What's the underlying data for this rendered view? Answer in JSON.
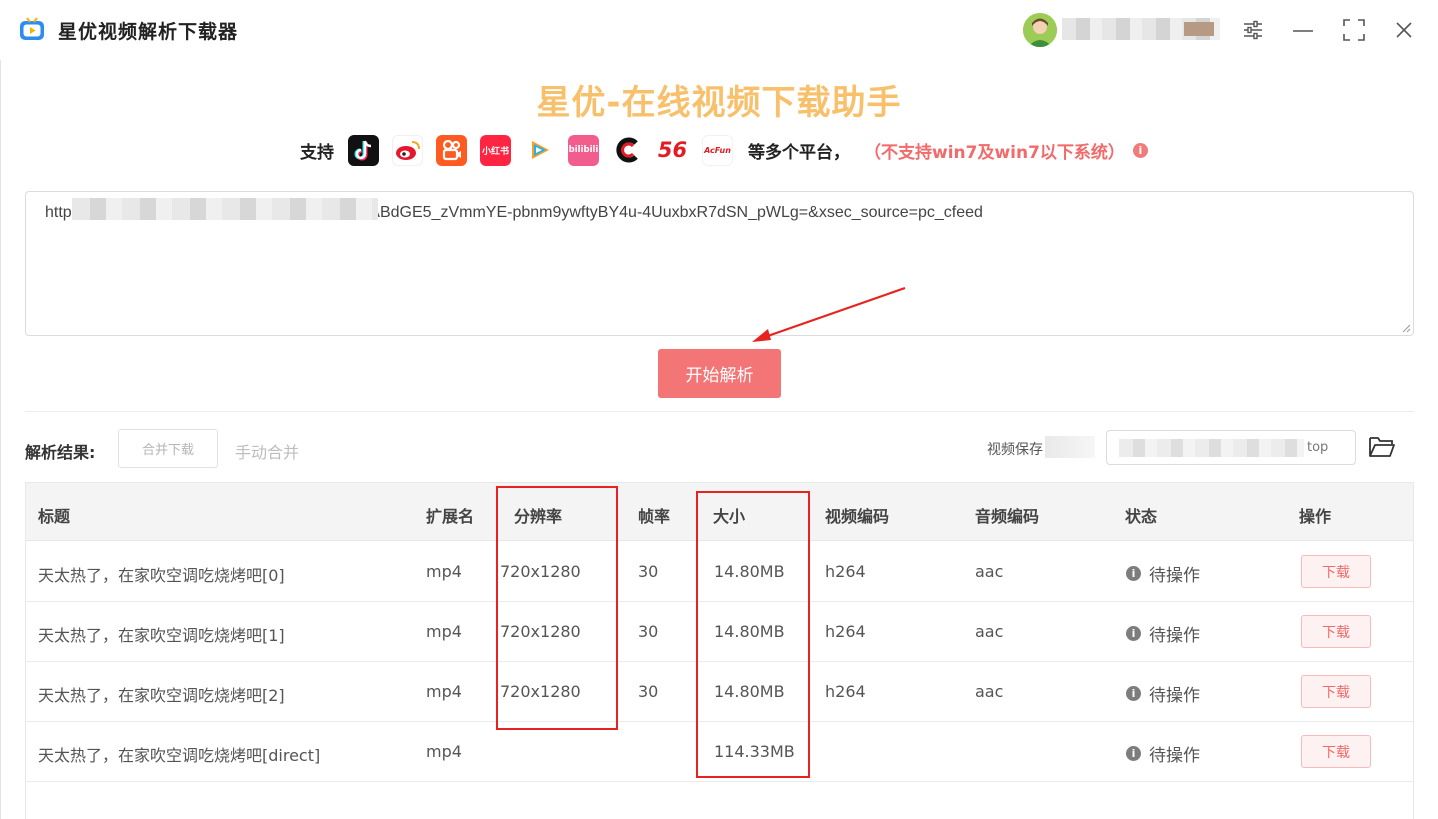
{
  "app": {
    "title": "星优视频解析下载器"
  },
  "window_controls": [
    "settings-icon",
    "minimize-icon",
    "maximize-icon",
    "close-icon"
  ],
  "header": {
    "headline": "星优-在线视频下载助手",
    "support_label": "支持",
    "support_more": "等多个平台，",
    "support_warning": "（不支持win7及win7以下系统）",
    "info_glyph": "i"
  },
  "platforms": [
    {
      "name": "tiktok-icon",
      "label": "",
      "bg": "#111111"
    },
    {
      "name": "weibo-icon",
      "label": "",
      "bg": "#ffffff"
    },
    {
      "name": "kuaishou-icon",
      "label": "",
      "bg": "#ff5a1f"
    },
    {
      "name": "xiaohongshu-icon",
      "label": "小红书",
      "bg": "#ff2442"
    },
    {
      "name": "tencent-video-icon",
      "label": "",
      "bg": "#ffffff"
    },
    {
      "name": "bilibili-icon",
      "label": "bilibili",
      "bg": "#f25d8e"
    },
    {
      "name": "cctv-icon",
      "label": "",
      "bg": "#ffffff"
    },
    {
      "name": "56-icon",
      "label": "56",
      "bg": "#ffffff"
    },
    {
      "name": "acfun-icon",
      "label": "AcFun",
      "bg": "#ffffff"
    }
  ],
  "url_input": {
    "value": "https                                              be2c90000000015032a58?xsec_token=ABdGE5_zVmmYE-pbnm9ywftyBY4u-4UuxbxR7dSN_pWLg=&xsec_source=pc_cfeed"
  },
  "parse_button": "开始解析",
  "results": {
    "label": "解析结果:",
    "merge_button": "合并下载",
    "manual_merge": "手动合并",
    "save_label": "视频保存",
    "save_path_tail": "top"
  },
  "table": {
    "columns": [
      "标题",
      "扩展名",
      "分辨率",
      "帧率",
      "大小",
      "视频编码",
      "音频编码",
      "状态",
      "操作"
    ],
    "rows": [
      {
        "title": "天太热了，在家吹空调吃烧烤吧[0]",
        "ext": "mp4",
        "resolution": "720x1280",
        "fps": "30",
        "size": "14.80MB",
        "vcodec": "h264",
        "acodec": "aac",
        "status": "待操作",
        "action": "下载"
      },
      {
        "title": "天太热了，在家吹空调吃烧烤吧[1]",
        "ext": "mp4",
        "resolution": "720x1280",
        "fps": "30",
        "size": "14.80MB",
        "vcodec": "h264",
        "acodec": "aac",
        "status": "待操作",
        "action": "下载"
      },
      {
        "title": "天太热了，在家吹空调吃烧烤吧[2]",
        "ext": "mp4",
        "resolution": "720x1280",
        "fps": "30",
        "size": "14.80MB",
        "vcodec": "h264",
        "acodec": "aac",
        "status": "待操作",
        "action": "下载"
      },
      {
        "title": "天太热了，在家吹空调吃烧烤吧[direct]",
        "ext": "mp4",
        "resolution": "",
        "fps": "",
        "size": "114.33MB",
        "vcodec": "",
        "acodec": "",
        "status": "待操作",
        "action": "下载"
      }
    ]
  },
  "colors": {
    "accent": "#f47575",
    "headline": "#f9c06c",
    "warning": "#f26a6a",
    "highlight": "#e8221f"
  }
}
